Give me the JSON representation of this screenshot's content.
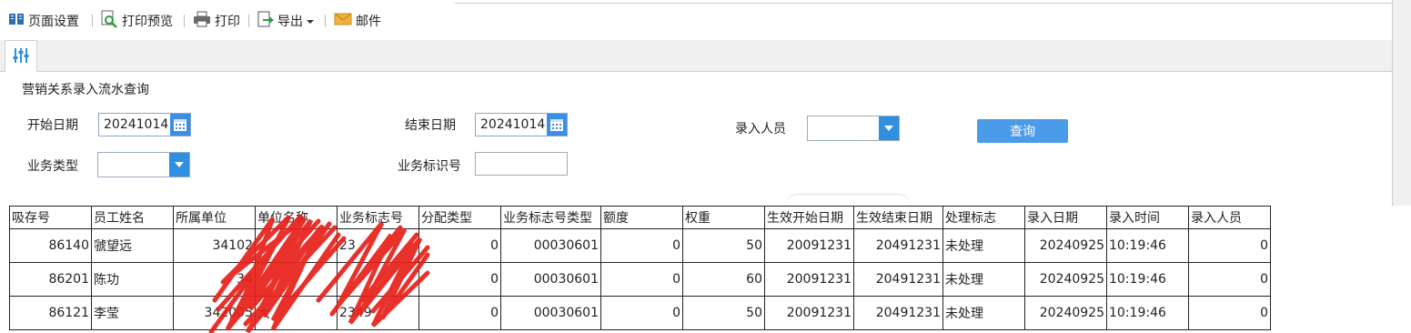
{
  "toolbar": {
    "page_setup": "页面设置",
    "print_preview": "打印预览",
    "print": "打印",
    "export": "导出",
    "mail": "邮件"
  },
  "form": {
    "title": "营销关系录入流水查询",
    "start_date_label": "开始日期",
    "start_date": "20241014",
    "end_date_label": "结束日期",
    "end_date": "20241014",
    "operator_label": "录入人员",
    "query_button": "查询",
    "biz_type_label": "业务类型",
    "biz_id_label": "业务标识号"
  },
  "table": {
    "headers": [
      "吸存号",
      "员工姓名",
      "所属单位",
      "单位名称",
      "业务标志号",
      "分配类型",
      "业务标志号类型",
      "额度",
      "权重",
      "生效开始日期",
      "生效结束日期",
      "处理标志",
      "录入日期",
      "录入时间",
      "录入人员"
    ],
    "rows": [
      [
        "86140",
        "虢望远",
        "34102",
        "",
        "23",
        "0",
        "00030601",
        "0",
        "50",
        "20091231",
        "20491231",
        "未处理",
        "20240925",
        "10:19:46",
        "0"
      ],
      [
        "86201",
        "陈功",
        "34",
        "",
        "",
        "0",
        "00030601",
        "0",
        "60",
        "20091231",
        "20491231",
        "未处理",
        "20240925",
        "10:19:46",
        "0"
      ],
      [
        "86121",
        "李莹",
        "342005",
        "大",
        "2349",
        "0",
        "00030601",
        "0",
        "50",
        "20091231",
        "20491231",
        "未处理",
        "20240925",
        "10:19:46",
        "0"
      ]
    ]
  },
  "icons": {
    "page_setup": "book-icon",
    "print_preview": "magnifier-icon",
    "print": "printer-icon",
    "export": "export-icon",
    "mail": "envelope-icon",
    "tab": "sliders-icon",
    "calendar": "calendar-icon",
    "dropdown": "chevron-down-icon"
  },
  "colors": {
    "accent": "#4a9ce8",
    "redaction": "#e8201a"
  }
}
